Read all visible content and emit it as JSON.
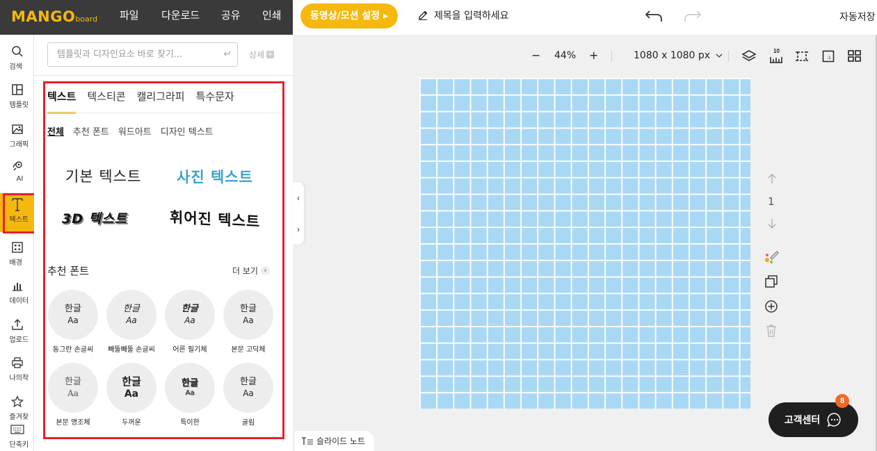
{
  "topbar": {
    "logo": "MANGO",
    "logo_sub": "board",
    "menu": [
      "파일",
      "다운로드",
      "공유",
      "인쇄"
    ],
    "motion_button": "동영상/모션 설정 ▸",
    "title_placeholder": "제목을 입력하세요",
    "autosave": "자동저장"
  },
  "iconbar": [
    {
      "label": "검색",
      "icon": "search-icon"
    },
    {
      "label": "템플릿",
      "icon": "template-icon"
    },
    {
      "label": "그래픽",
      "icon": "graphic-icon"
    },
    {
      "label": "AI",
      "icon": "ai-icon"
    },
    {
      "label": "텍스트",
      "icon": "text-icon",
      "active": true
    },
    {
      "label": "배경",
      "icon": "background-icon"
    },
    {
      "label": "데이터",
      "icon": "chart-icon"
    },
    {
      "label": "업로드",
      "icon": "upload-icon"
    },
    {
      "label": "나의작업",
      "icon": "print-icon"
    },
    {
      "label": "즐겨찾기",
      "icon": "star-icon"
    },
    {
      "label": "단축키",
      "icon": "keyboard-icon"
    }
  ],
  "panel": {
    "search_placeholder": "템플릿과 디자인요소 바로 찾기...",
    "search_enter": "↵",
    "detail_label": "상세",
    "tabs": [
      "텍스트",
      "텍스티콘",
      "캘리그라피",
      "특수문자"
    ],
    "subtabs": [
      "전체",
      "추천 폰트",
      "워드아트",
      "디자인 텍스트"
    ],
    "samples": {
      "basic": "기본 텍스트",
      "photo": "사진 텍스트",
      "three_d": "3D 텍스트",
      "warp": "휘어진 텍스트"
    },
    "recommended_title": "추천 폰트",
    "more_label": "더 보기",
    "fonts": [
      {
        "k": "한글",
        "a": "Aa",
        "name": "동그란 손글씨"
      },
      {
        "k": "한글",
        "a": "Aa",
        "name": "빼뚤빼뚤 손글씨"
      },
      {
        "k": "한글",
        "a": "Aa",
        "name": "어른 필기체"
      },
      {
        "k": "한글",
        "a": "Aa",
        "name": "본문 고딕체"
      },
      {
        "k": "한글",
        "a": "Aa",
        "name": "본문 명조체"
      },
      {
        "k": "한글",
        "a": "Aa",
        "name": "두꺼운"
      },
      {
        "k": "한글",
        "a": "Aa",
        "name": "특이한"
      },
      {
        "k": "한글",
        "a": "Aa",
        "name": "굴림"
      }
    ]
  },
  "canvas_toolbar": {
    "minus": "−",
    "zoom": "44%",
    "plus": "+",
    "size": "1080 x 1080 px",
    "grid_label": "10"
  },
  "side": {
    "page": "1"
  },
  "help": {
    "label": "고객센터",
    "badge": "8"
  },
  "note_tab": "슬라이드 노트",
  "colors": {
    "accent": "#f5b80f",
    "highlight": "#e8202a",
    "canvas": "#a9d8f4"
  }
}
